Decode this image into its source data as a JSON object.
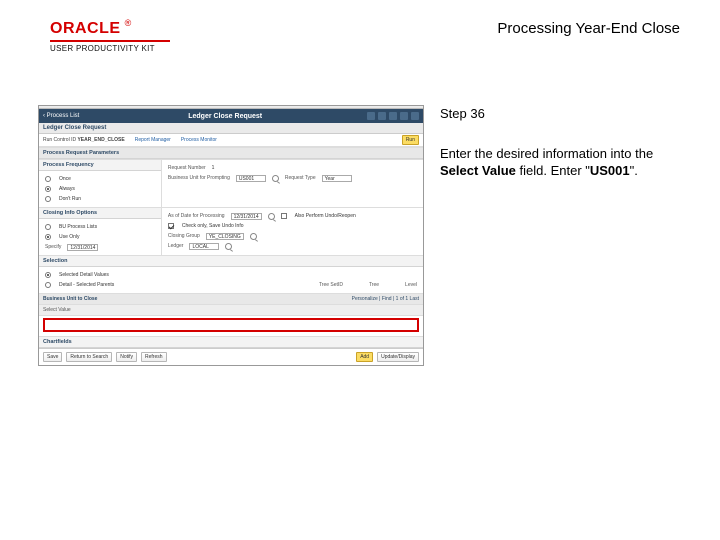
{
  "header": {
    "brand_word": "ORACLE",
    "brand_upk": "USER PRODUCTIVITY KIT",
    "doc_title": "Processing Year-End Close"
  },
  "right": {
    "step_label": "Step 36",
    "instr_pre": "Enter the desired information into the ",
    "instr_bold1": "Select Value",
    "instr_mid": " field. Enter \"",
    "instr_bold2": "US001",
    "instr_post": "\"."
  },
  "app": {
    "navbar": {
      "back": "‹ Process List",
      "title": "Ledger Close Request"
    },
    "breadcrumb": {
      "label": "Ledger Close Request"
    },
    "meta": {
      "run_control_k": "Run Control ID",
      "run_control_v": "YEAR_END_CLOSE",
      "report_mgr": "Report Manager",
      "proc_mon": "Process Monitor",
      "run_btn": "Run"
    },
    "panels": {
      "proc_req_params": "Process Request Parameters",
      "proc_freq": "Process Frequency",
      "closing_option": "Closing Info Options",
      "selection": "Selection",
      "bu_to_close": "Business Unit to Close",
      "chartfields": "Chartfields"
    },
    "req": {
      "request_num_k": "Request Number",
      "request_num_v": "1",
      "bu_k": "Business Unit for Prompting",
      "bu_v": "US001",
      "request_type_k": "Request Type",
      "request_type_v": "Year"
    },
    "freq": {
      "once": "Once",
      "always": "Always",
      "dont_run": "Don't Run"
    },
    "closing": {
      "process_date_k": "As of Date for Processing",
      "process_date_v": "12/31/2014",
      "undo_chk": "Also Perform Undo/Reopen",
      "create_chk": "Check only, Save Undo Info",
      "proc_list_k": "BU Process Lists",
      "proc_list2_k": "Use Only",
      "date_k": "Specify",
      "date_v": "12/31/2014",
      "closing_group_k": "Closing Group",
      "closing_group_v": "YE_CLOSING",
      "ledger_k": "Ledger",
      "ledger_v": "LOCAL"
    },
    "selection": {
      "opt1": "Selected Detail Values",
      "opt2": "Detail - Selected Parents",
      "grid_headers": {
        "c1": "Tree SetID",
        "c2": "Tree",
        "c3": "Level"
      },
      "grid_row": {
        "c1": "",
        "c2": "",
        "c3": ""
      }
    },
    "bu_bar": {
      "left": "Select Value",
      "right": "Personalize | Find |   1 of 1   Last"
    },
    "footer": {
      "save": "Save",
      "return": "Return to Search",
      "notify": "Notify",
      "refresh": "Refresh",
      "add": "Add",
      "update": "Update/Display"
    }
  }
}
